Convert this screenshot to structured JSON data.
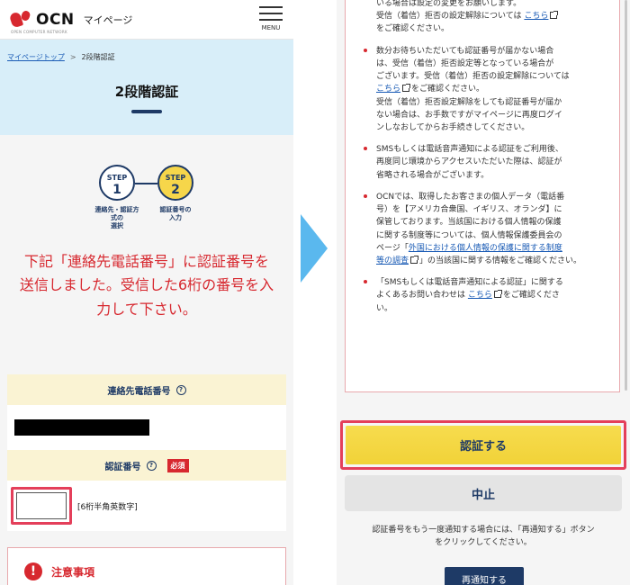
{
  "header": {
    "brand": "OCN",
    "brand_sub": "OPEN COMPUTER NETWORK",
    "title": "マイページ",
    "menu_label": "MENU"
  },
  "breadcrumb": {
    "home": "マイページトップ",
    "separator": ">",
    "current": "2段階認証"
  },
  "page_title": "2段階認証",
  "steps": [
    {
      "label": "STEP",
      "number": "1",
      "caption_l1": "連絡先・認証方",
      "caption_l2": "式の",
      "caption_l3": "選択"
    },
    {
      "label": "STEP",
      "number": "2",
      "caption_l1": "認証番号の",
      "caption_l2": "入力"
    }
  ],
  "instruction": {
    "line1": "下記「連絡先電話番号」に認証番号を",
    "line2": "送信しました。受信した6桁の番号を入",
    "line3": "力して下さい。"
  },
  "form": {
    "phone_label": "連絡先電話番号",
    "code_label": "認証番号",
    "required": "必須",
    "code_hint": "[6桁半角英数字]",
    "help": "?"
  },
  "caution": {
    "icon": "!",
    "title": "注意事項"
  },
  "notes": {
    "n0_l1": "いる場合は設定の変更をお願いします。",
    "n0_l2a": "受信（着信）拒否の設定解除については",
    "n0_link": "こちら",
    "n0_l3": "をご確認ください。",
    "n1_l1": "数分お待ちいただいても認証番号が届かない場合",
    "n1_l2": "は、受信（着信）拒否設定等となっている場合が",
    "n1_l3": "ございます。受信（着信）拒否の設定解除については",
    "n1_link": "こちら",
    "n1_l4b": "をご確認ください。",
    "n1_l5": "受信（着信）拒否設定解除をしても認証番号が届か",
    "n1_l6": "ない場合は、お手数ですがマイページに再度ログイ",
    "n1_l7": "ンしなおしてからお手続きしてください。",
    "n2_l1": "SMSもしくは電話音声通知による認証をご利用後、",
    "n2_l2": "再度同じ環境からアクセスいただいた際は、認証が",
    "n2_l3": "省略される場合がございます。",
    "n3_l1": "OCNでは、取得したお客さまの個人データ（電話番",
    "n3_l2": "号）を【アメリカ合衆国、イギリス、オランダ】に",
    "n3_l3": "保管しております。当該国における個人情報の保護",
    "n3_l4": "に関する制度等については、個人情報保護委員会の",
    "n3_l5a": "ページ「",
    "n3_link1": "外国における個人情報の保護に関する制度",
    "n3_link2": "等の調査",
    "n3_l6b": "」の当該国に関する情報をご確認ください。",
    "n4_l1": "「SMSもしくは電話音声通知による認証」に関する",
    "n4_l2a": "よくあるお問い合わせは",
    "n4_link": "こちら",
    "n4_l2b": "をご確認くださ",
    "n4_l3": "い。"
  },
  "buttons": {
    "authenticate": "認証する",
    "cancel": "中止",
    "resend": "再通知する"
  },
  "resend_text": {
    "line1": "認証番号をもう一度通知する場合には、「再通知する」ボタン",
    "line2": "をクリックしてください。"
  },
  "colors": {
    "accent_red": "#d7282f",
    "navy": "#1e3a66",
    "yellow": "#f6d64a",
    "arrow_blue": "#5ab8ee",
    "hero_bg": "#d8eef9"
  }
}
